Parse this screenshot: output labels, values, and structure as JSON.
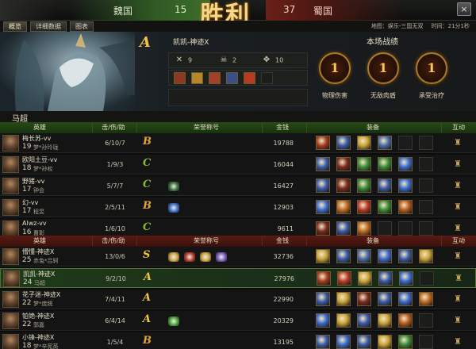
{
  "top": {
    "wei_name": "魏国",
    "wei_kills": "15",
    "victory": "胜利",
    "shu_kills": "37",
    "shu_name": "蜀国",
    "close": "×"
  },
  "tabs": [
    {
      "label": "概览",
      "active": true
    },
    {
      "label": "详细数据",
      "active": false
    },
    {
      "label": "图表",
      "active": false
    }
  ],
  "info": {
    "map": "地图：娱乐-三国无双",
    "duration": "时间：21分1秒"
  },
  "hero": {
    "grade": "A",
    "title": "凯凯-神迹X",
    "kills_icon": "crossed-swords-icon",
    "kills": "9",
    "deaths_icon": "skull-icon",
    "deaths": "2",
    "assists_icon": "handshake-icon",
    "assists": "10"
  },
  "stats": {
    "title": "本场战绩",
    "medals": [
      {
        "value": "1",
        "label": "物理伤害"
      },
      {
        "value": "1",
        "label": "无敌肉盾"
      },
      {
        "value": "1",
        "label": "承受治疗"
      }
    ]
  },
  "subtitle": "马超",
  "headers": {
    "hero": "英雄",
    "kda": "击/伤/助",
    "honor": "荣誉称号",
    "gold": "金钱",
    "equip": "装备",
    "interact": "互动"
  },
  "wei_players": [
    {
      "name": "梅长苏-vv",
      "level": "19",
      "hero": "梦*孙玲珑",
      "kda": "6/10/7",
      "grade": "B",
      "badges": [],
      "gold": "19788"
    },
    {
      "name": "欧阳土豆-vv",
      "level": "18",
      "hero": "梦*孙权",
      "kda": "1/9/3",
      "grade": "C",
      "badges": [],
      "gold": "16044"
    },
    {
      "name": "野猪-vv",
      "level": "17",
      "hero": "钟会",
      "kda": "5/7/7",
      "grade": "C",
      "badges": [
        "#3a6d3a"
      ],
      "gold": "16427"
    },
    {
      "name": "幻-vv",
      "level": "17",
      "hero": "程昱",
      "kda": "2/5/11",
      "grade": "B",
      "badges": [
        "#3e6ec0"
      ],
      "gold": "12903"
    },
    {
      "name": "Alwz-vv",
      "level": "16",
      "hero": "曹彰",
      "kda": "1/6/10",
      "grade": "C",
      "badges": [],
      "gold": "9611"
    }
  ],
  "shu_players": [
    {
      "name": "懵懂-神迹X",
      "level": "25",
      "hero": "赤兔*吕轲",
      "kda": "13/0/6",
      "grade": "S",
      "badges": [
        "#c9a23a",
        "#b83a2a",
        "#c9a23a",
        "#7a5bb8"
      ],
      "gold": "32736"
    },
    {
      "name": "凯凯-神迹X",
      "level": "24",
      "hero": "马超",
      "kda": "9/2/10",
      "grade": "A",
      "badges": [],
      "gold": "27976",
      "highlight": true
    },
    {
      "name": "花子迷-神迹X",
      "level": "22",
      "hero": "梦*庞统",
      "kda": "7/4/11",
      "grade": "A",
      "badges": [],
      "gold": "22990"
    },
    {
      "name": "铂铯-神迹X",
      "level": "22",
      "hero": "郭嘉",
      "kda": "6/4/14",
      "grade": "A",
      "badges": [
        "#4aa03a"
      ],
      "gold": "20329"
    },
    {
      "name": "小锋-神迹X",
      "level": "18",
      "hero": "梦*辛宪英",
      "kda": "1/5/4",
      "grade": "B",
      "badges": [],
      "gold": "13195"
    }
  ],
  "item_colors": {
    "wei": [
      [
        "#a33a22",
        "#3a5aa8",
        "#c9a23a",
        "#4a6aa8",
        null,
        null
      ],
      [
        "#3a5aa8",
        "#7a2a22",
        "#3a8a3a",
        "#3a8a3a",
        "#3a6ad0",
        null
      ],
      [
        "#3a5aa8",
        "#7a2a22",
        "#3a8a3a",
        "#3a5aa8",
        "#3a6ad0",
        null
      ],
      [
        "#3a6ad0",
        "#c06a22",
        "#b83a2a",
        "#3a8a3a",
        "#b85a22",
        null
      ],
      [
        "#7a2a22",
        "#3a5aa8",
        "#c06a22",
        null,
        null,
        null
      ]
    ],
    "shu": [
      [
        "#c9a23a",
        "#3a5aa8",
        "#4a6aa8",
        "#3a6ad0",
        "#3a5aa8",
        "#c9a23a"
      ],
      [
        "#a33a22",
        "#b83a2a",
        "#c9a23a",
        "#3a5aa8",
        "#3a6ad0",
        null
      ],
      [
        "#3a5aa8",
        "#c9a23a",
        "#7a2a22",
        "#3a5aa8",
        "#3a6ad0",
        "#c06a22"
      ],
      [
        "#3a6ad0",
        "#c9a23a",
        "#3a5aa8",
        "#c9a23a",
        "#b85a22",
        null
      ],
      [
        "#3a5aa8",
        "#3a6ad0",
        "#3a5aa8",
        "#c9a23a",
        "#3a8a3a",
        null
      ]
    ]
  },
  "colors": {
    "wei_header": "#274a18",
    "shu_header": "#5a1a14",
    "grade_gold": "#f0c44a"
  }
}
